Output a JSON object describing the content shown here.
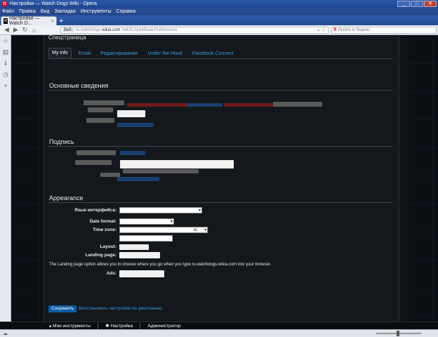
{
  "window": {
    "title": "Настройки — Watch Dogs Wiki - Opera",
    "minimize": "_",
    "maximize": "□",
    "close": "✕"
  },
  "menu": [
    "Файл",
    "Правка",
    "Вид",
    "Закладки",
    "Инструменты",
    "Справка"
  ],
  "browser_tab": {
    "label": "Настройки — Watch D...",
    "favicon": "W",
    "close": "×",
    "new_tab": "+"
  },
  "address": {
    "web_chip": "Веб",
    "url_domain": "ru.watchdogs.wikia.com",
    "url_path": "/wiki/Служебная:Preferences",
    "search_placeholder": "Искать в Яндекс",
    "search_brand": "Я"
  },
  "page": {
    "heading": "Спецстраница",
    "tabs": [
      {
        "label": "My info",
        "active": true
      },
      {
        "label": "Email",
        "active": false
      },
      {
        "label": "Редактирование",
        "active": false
      },
      {
        "label": "Under the Hood",
        "active": false
      },
      {
        "label": "Facebook Connect",
        "active": false
      }
    ],
    "sections": {
      "basic": "Основные сведения",
      "signature": "Подпись",
      "appearance": "Appearance"
    },
    "fields": {
      "language": "Язык интерфейса:",
      "date_format": "Date format:",
      "time_zone": "Time zone:",
      "time_zone_value": "e)",
      "layout": "Layout:",
      "landing_page": "Landing page:",
      "ads": "Ads:"
    },
    "landing_note": "The Landing page option allows you to choose where you go when you type ru.watchdogs.wikia.com into your browser.",
    "save_button": "Сохранить",
    "restore_link": "Восстановить настройки по умолчанию"
  },
  "wiki_toolbar": {
    "my_tools": "Мои инструменты",
    "settings": "Настройка",
    "admin": "Администратор"
  },
  "colors": {
    "link": "#3a9ad9",
    "save_button": "#0b5da6",
    "opera_blue": "#2c5aa8"
  }
}
